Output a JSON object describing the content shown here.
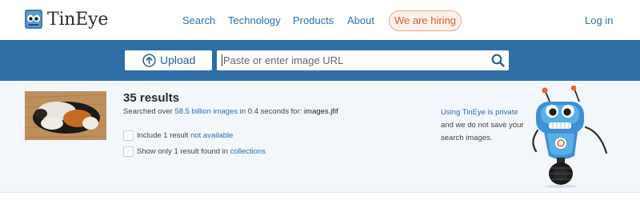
{
  "header": {
    "brand": "TinEye",
    "nav": [
      "Search",
      "Technology",
      "Products",
      "About"
    ],
    "hiring_label": "We are hiring",
    "login_label": "Log in"
  },
  "search": {
    "upload_label": "Upload",
    "url_placeholder": "Paste or enter image URL",
    "url_value": ""
  },
  "results": {
    "count_label": "35 results",
    "searched_prefix": "Searched over ",
    "searched_count": "58.5 billion images",
    "searched_middle": " in 0.4 seconds for: ",
    "file_name": "images.jfif",
    "filter_unavailable_prefix": "Include 1 result ",
    "filter_unavailable_link": "not available",
    "filter_collections_prefix": "Show only 1 result found in ",
    "filter_collections_link": "collections"
  },
  "privacy": {
    "link": "Using TinEye is private",
    "line2": "and we do not save your",
    "line3": "search images."
  },
  "colors": {
    "band": "#2f6ea6",
    "link": "#2d6ea8",
    "hiring_text": "#d2622a",
    "results_bg": "#f3f6fb"
  },
  "icons": [
    "tineye-logo-icon",
    "upload-arrow-icon",
    "search-icon",
    "robot-mascot-icon"
  ]
}
